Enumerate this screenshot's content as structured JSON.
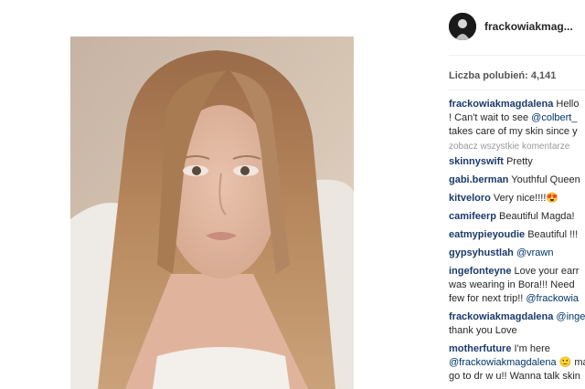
{
  "post": {
    "username": "frackowiakmag...",
    "likes": "Liczba polubień: 4,141"
  },
  "caption": {
    "user": "frackowiakmagdalena",
    "line1": "Hello",
    "line2_a": "! Can't wait to see ",
    "line2_mention": "@colbert_",
    "line3": "takes care of my skin since y"
  },
  "view_all": "zobacz wszystkie komentarze",
  "comments": [
    {
      "user": "skinnyswift",
      "text": "Pretty"
    },
    {
      "user": "gabi.berman",
      "text": "Youthful Queen"
    },
    {
      "user": "kitveloro",
      "text": "Very nice!!!!😍"
    },
    {
      "user": "camifeerp",
      "text": "Beautiful Magda!"
    },
    {
      "user": "eatmypieyoudie",
      "text": "Beautiful !!!"
    },
    {
      "user": "gypsyhustlah",
      "mention": "@vrawn"
    }
  ],
  "comment_inge": {
    "user": "ingefonteyne",
    "line1": "Love your earr",
    "line2": "was wearing in Bora!!! Need",
    "line3_a": "few for next trip!! ",
    "line3_mention": "@frackowia"
  },
  "comment_reply": {
    "user": "frackowiakmagdalena",
    "mention": "@inge",
    "line2": "thank you Love"
  },
  "comment_mother": {
    "user": "motherfuture",
    "line1": "I'm here",
    "line2_mention": "@frackowiakmagdalena",
    "line2_b": " 🙂 ma",
    "line3": "go to dr w u!! Wanna talk skin"
  }
}
